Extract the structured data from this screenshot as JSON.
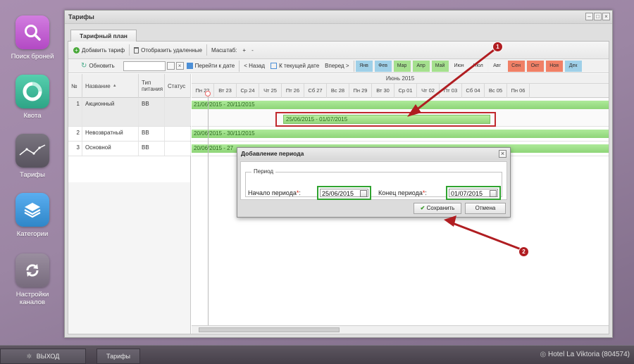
{
  "launcher": [
    {
      "label": "Поиск броней",
      "icon": "search-icon",
      "color": "#c45bd2"
    },
    {
      "label": "Квота",
      "icon": "pie-chart-icon",
      "color": "#3fb89a"
    },
    {
      "label": "Тарифы",
      "icon": "line-chart-icon",
      "color": "#6e6a73"
    },
    {
      "label": "Категории",
      "icon": "layers-icon",
      "color": "#3d96d8"
    },
    {
      "label": "Настройки каналов",
      "icon": "sync-icon",
      "color": "#8b7f90"
    }
  ],
  "window": {
    "title": "Тарифы",
    "tab": "Тарифный план"
  },
  "toolbar": {
    "add_tariff": "Добавить тариф",
    "show_deleted": "Отобразить удаленные",
    "scale": "Масштаб:",
    "plus": "+",
    "minus": "-"
  },
  "toolbar2": {
    "refresh": "Обновить",
    "goto_date": "Перейти к дате",
    "back": "< Назад",
    "to_current": "К текущей дате",
    "forward": "Вперед >",
    "months": [
      {
        "label": "Янв",
        "color": "#9fd0e8"
      },
      {
        "label": "Фев",
        "color": "#9fd0e8"
      },
      {
        "label": "Мар",
        "color": "#a5e08e"
      },
      {
        "label": "Апр",
        "color": "#a5e08e"
      },
      {
        "label": "Май",
        "color": "#a5e08e"
      },
      {
        "label": "Июн",
        "color": "#f2f2f2"
      },
      {
        "label": "Июл",
        "color": "#f2f2f2"
      },
      {
        "label": "Авг",
        "color": "#f2f2f2"
      },
      {
        "label": "Сен",
        "color": "#f08066"
      },
      {
        "label": "Окт",
        "color": "#f08066"
      },
      {
        "label": "Ноя",
        "color": "#f08066"
      },
      {
        "label": "Дек",
        "color": "#9fd0e8"
      }
    ]
  },
  "grid": {
    "headers": {
      "num": "№",
      "name": "Название",
      "sort_arrow": "▲",
      "meal": "Тип питания",
      "status": "Статус"
    },
    "month": "Июнь 2015",
    "days": [
      "Пн 22",
      "Вт 23",
      "Ср 24",
      "Чт 25",
      "Пт 26",
      "Сб 27",
      "Вс 28",
      "Пн 29",
      "Вт 30",
      "Ср 01",
      "Чт 02",
      "Пт 03",
      "Сб 04",
      "Вс 05",
      "Пн 06"
    ],
    "rows": [
      {
        "num": "1",
        "name": "Акционный",
        "meal": "BB",
        "period": "21/06/2015 - 20/11/2015",
        "new_period": "25/06/2015 - 01/07/2015"
      },
      {
        "num": "2",
        "name": "Невозвратный",
        "meal": "BB",
        "period": "20/06/2015 - 30/11/2015"
      },
      {
        "num": "3",
        "name": "Основной",
        "meal": "BB",
        "period": "20/06/2015 - 27"
      }
    ]
  },
  "dialog": {
    "title": "Добавление периода",
    "legend": "Период",
    "start_label": "Начало периода",
    "start_value": "25/06/2015",
    "end_label": "Конец периода",
    "end_value": "01/07/2015",
    "required_mark": "*",
    "colon": ":",
    "save": "Сохранить",
    "cancel": "Отмена"
  },
  "annotations": {
    "badge1": "1",
    "badge2": "2",
    "color": "#b01d21"
  },
  "taskbar": {
    "exit": "ВЫХОД",
    "tab": "Тарифы",
    "hotel": "Hotel La Viktoria (804574)"
  }
}
